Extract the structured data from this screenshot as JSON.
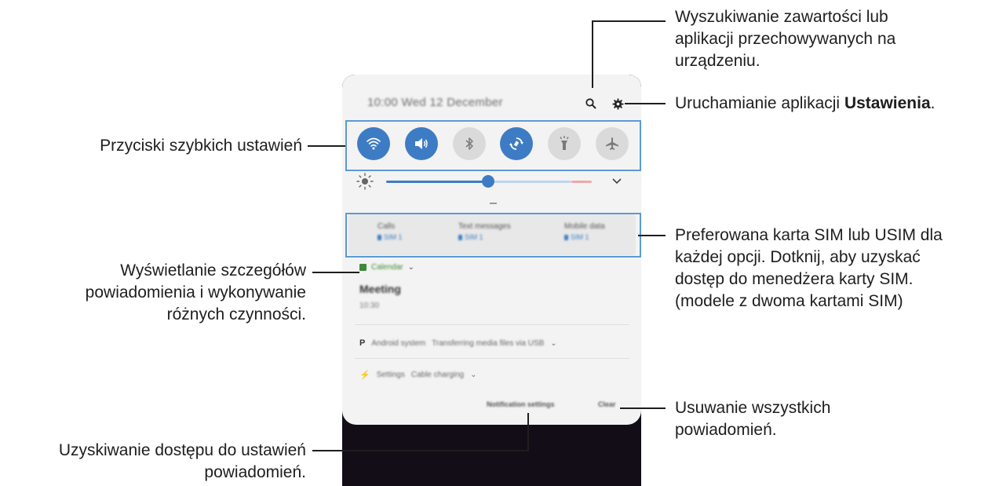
{
  "phone": {
    "status_time": "10:00 Wed 12 December",
    "quick_settings": [
      {
        "name": "wifi",
        "state": "on"
      },
      {
        "name": "sound",
        "state": "on"
      },
      {
        "name": "bluetooth",
        "state": "off"
      },
      {
        "name": "auto-rotate",
        "state": "on"
      },
      {
        "name": "flashlight",
        "state": "off"
      },
      {
        "name": "airplane-mode",
        "state": "off"
      }
    ],
    "brightness_level": 0.45,
    "sim": {
      "columns": [
        {
          "title": "Calls",
          "sim": "SIM 1"
        },
        {
          "title": "Text messages",
          "sim": "SIM 1"
        },
        {
          "title": "Mobile data",
          "sim": "SIM 1"
        }
      ]
    },
    "notifications": {
      "calendar_app": "Calendar",
      "calendar_title": "Meeting",
      "calendar_time": "10:30",
      "android_app": "Android system",
      "android_text": "Transferring media files via USB",
      "settings_app": "Settings",
      "settings_text": "Cable charging"
    },
    "footer": {
      "notification_settings": "Notification settings",
      "clear": "Clear"
    },
    "accent_color": "#3d7cc4"
  },
  "callouts": {
    "search": [
      "Wyszukiwanie zawartości lub",
      "aplikacji przechowywanych na",
      "urządzeniu."
    ],
    "settings_prefix": "Uruchamianie aplikacji ",
    "settings_bold": "Ustawienia",
    "settings_suffix": ".",
    "quick": "Przyciski szybkich ustawień",
    "sim": [
      "Preferowana karta SIM lub USIM dla",
      "każdej opcji. Dotknij, aby uzyskać",
      "dostęp do menedżera karty SIM.",
      "(modele z dwoma kartami SIM)"
    ],
    "details": [
      "Wyświetlanie szczegółów",
      "powiadomienia i wykonywanie",
      "różnych czynności."
    ],
    "clear": [
      "Usuwanie wszystkich",
      "powiadomień."
    ],
    "notif_settings": [
      "Uzyskiwanie dostępu do ustawień",
      "powiadomień."
    ]
  }
}
